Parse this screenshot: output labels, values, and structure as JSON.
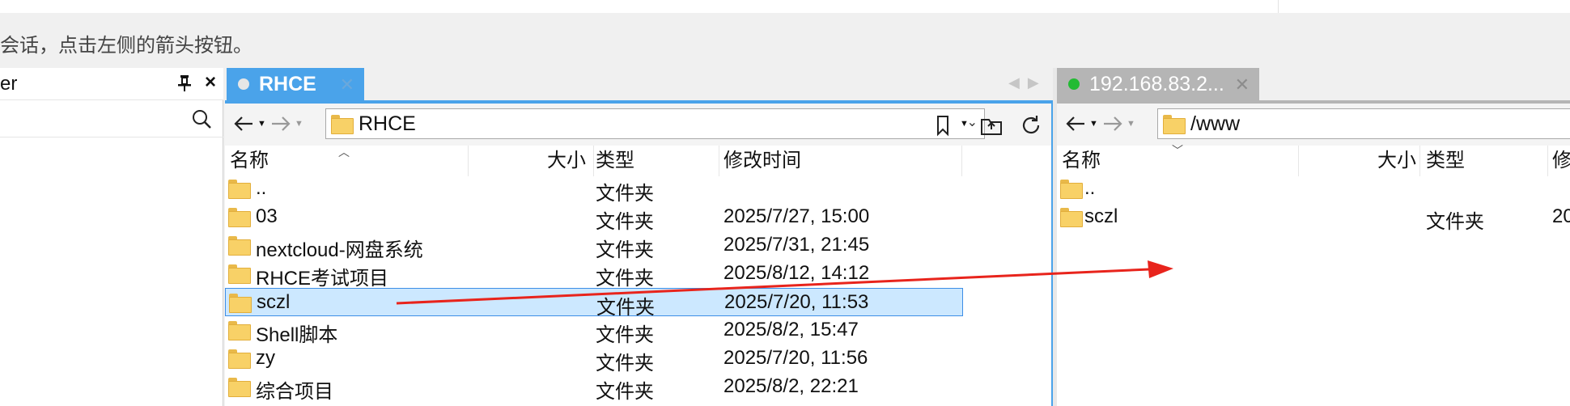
{
  "hint_text": "会话，点击左侧的箭头按钮。",
  "side_panel": {
    "title": "er"
  },
  "left_pane": {
    "tab": {
      "label": "RHCE",
      "dot_color": "#e6e6e6"
    },
    "path": "RHCE",
    "columns": {
      "name": "名称",
      "size": "大小",
      "type": "类型",
      "modified": "修改时间"
    },
    "rows": [
      {
        "name": "..",
        "size": "",
        "type": "文件夹",
        "modified": ""
      },
      {
        "name": "03",
        "size": "",
        "type": "文件夹",
        "modified": "2025/7/27, 15:00"
      },
      {
        "name": "nextcloud-网盘系统",
        "size": "",
        "type": "文件夹",
        "modified": "2025/7/31, 21:45"
      },
      {
        "name": "RHCE考试项目",
        "size": "",
        "type": "文件夹",
        "modified": "2025/8/12, 14:12"
      },
      {
        "name": "sczl",
        "size": "",
        "type": "文件夹",
        "modified": "2025/7/20, 11:53",
        "selected": true
      },
      {
        "name": "Shell脚本",
        "size": "",
        "type": "文件夹",
        "modified": "2025/8/2, 15:47"
      },
      {
        "name": "zy",
        "size": "",
        "type": "文件夹",
        "modified": "2025/7/20, 11:56"
      },
      {
        "name": "综合项目",
        "size": "",
        "type": "文件夹",
        "modified": "2025/8/2, 22:21"
      }
    ]
  },
  "right_pane": {
    "tab": {
      "label": "192.168.83.2...",
      "dot_color": "#22bb33"
    },
    "path": "/www",
    "columns": {
      "name": "名称",
      "size": "大小",
      "type": "类型",
      "modified": "修"
    },
    "rows": [
      {
        "name": "..",
        "size": "",
        "type": "",
        "modified": ""
      },
      {
        "name": "sczl",
        "size": "",
        "type": "文件夹",
        "modified": "20"
      }
    ]
  },
  "colors": {
    "accent": "#4aa3ea",
    "selection": "#cce8ff",
    "annotation_arrow": "#e8241c"
  }
}
